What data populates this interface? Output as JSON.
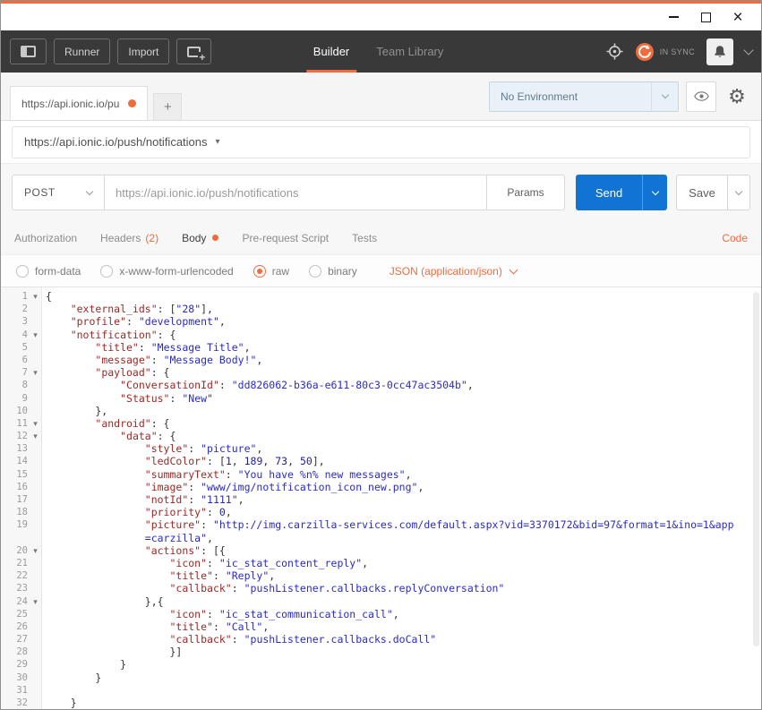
{
  "colors": {
    "accent_orange": "#f26b3a",
    "header_bg": "#393939",
    "send_button_blue": "#1173d4",
    "key_token": "#9c2724",
    "string_token": "#2a2ac9"
  },
  "icons": {
    "close_glyph": "×",
    "gear_glyph": "⚙",
    "caret_glyph": "▾",
    "fold_glyph": "▾"
  },
  "header": {
    "runner_label": "Runner",
    "import_label": "Import",
    "tabs": [
      {
        "label": "Builder",
        "active": true
      },
      {
        "label": "Team Library",
        "active": false
      }
    ],
    "sync_status": "IN SYNC"
  },
  "env_bar": {
    "request_tab": "https://api.ionic.io/pu",
    "new_tab_label": "+",
    "environment_select": "No Environment"
  },
  "request_name": "https://api.ionic.io/push/notifications",
  "request": {
    "method": "POST",
    "url": "https://api.ionic.io/push/notifications",
    "params_label": "Params",
    "send_label": "Send",
    "save_label": "Save"
  },
  "request_tabs": {
    "items": [
      {
        "label": "Authorization",
        "active": false
      },
      {
        "label": "Headers",
        "count": "(2)",
        "active": false
      },
      {
        "label": "Body",
        "active": true,
        "dot": true
      },
      {
        "label": "Pre-request Script",
        "active": false
      },
      {
        "label": "Tests",
        "active": false
      }
    ],
    "code_link": "Code"
  },
  "body_options": {
    "radios": [
      {
        "label": "form-data",
        "selected": false
      },
      {
        "label": "x-www-form-urlencoded",
        "selected": false
      },
      {
        "label": "raw",
        "selected": true
      },
      {
        "label": "binary",
        "selected": false
      }
    ],
    "content_type": "JSON (application/json)"
  },
  "editor": {
    "lines": [
      {
        "n": "1",
        "fold": true,
        "t": [
          [
            "p",
            "{"
          ]
        ]
      },
      {
        "n": "2",
        "t": [
          [
            "p",
            "    "
          ],
          [
            "k",
            "\"external_ids\""
          ],
          [
            "p",
            ": ["
          ],
          [
            "s",
            "\"28\""
          ],
          [
            "p",
            "],"
          ]
        ]
      },
      {
        "n": "3",
        "t": [
          [
            "p",
            "    "
          ],
          [
            "k",
            "\"profile\""
          ],
          [
            "p",
            ": "
          ],
          [
            "s",
            "\"development\""
          ],
          [
            "p",
            ","
          ]
        ]
      },
      {
        "n": "4",
        "fold": true,
        "t": [
          [
            "p",
            "    "
          ],
          [
            "k",
            "\"notification\""
          ],
          [
            "p",
            ": {"
          ]
        ]
      },
      {
        "n": "5",
        "t": [
          [
            "p",
            "        "
          ],
          [
            "k",
            "\"title\""
          ],
          [
            "p",
            ": "
          ],
          [
            "s",
            "\"Message Title\""
          ],
          [
            "p",
            ","
          ]
        ]
      },
      {
        "n": "6",
        "t": [
          [
            "p",
            "        "
          ],
          [
            "k",
            "\"message\""
          ],
          [
            "p",
            ": "
          ],
          [
            "s",
            "\"Message Body!\""
          ],
          [
            "p",
            ","
          ]
        ]
      },
      {
        "n": "7",
        "fold": true,
        "t": [
          [
            "p",
            "        "
          ],
          [
            "k",
            "\"payload\""
          ],
          [
            "p",
            ": {"
          ]
        ]
      },
      {
        "n": "8",
        "t": [
          [
            "p",
            "            "
          ],
          [
            "k",
            "\"ConversationId\""
          ],
          [
            "p",
            ": "
          ],
          [
            "s",
            "\"dd826062-b36a-e611-80c3-0cc47ac3504b\""
          ],
          [
            "p",
            ","
          ]
        ]
      },
      {
        "n": "9",
        "t": [
          [
            "p",
            "            "
          ],
          [
            "k",
            "\"Status\""
          ],
          [
            "p",
            ": "
          ],
          [
            "s",
            "\"New\""
          ]
        ]
      },
      {
        "n": "10",
        "t": [
          [
            "p",
            "        },"
          ]
        ]
      },
      {
        "n": "11",
        "fold": true,
        "t": [
          [
            "p",
            "        "
          ],
          [
            "k",
            "\"android\""
          ],
          [
            "p",
            ": {"
          ]
        ]
      },
      {
        "n": "12",
        "fold": true,
        "t": [
          [
            "p",
            "            "
          ],
          [
            "k",
            "\"data\""
          ],
          [
            "p",
            ": {"
          ]
        ]
      },
      {
        "n": "13",
        "t": [
          [
            "p",
            "                "
          ],
          [
            "k",
            "\"style\""
          ],
          [
            "p",
            ": "
          ],
          [
            "s",
            "\"picture\""
          ],
          [
            "p",
            ","
          ]
        ]
      },
      {
        "n": "14",
        "t": [
          [
            "p",
            "                "
          ],
          [
            "k",
            "\"ledColor\""
          ],
          [
            "p",
            ": ["
          ],
          [
            "d",
            "1"
          ],
          [
            "p",
            ", "
          ],
          [
            "d",
            "189"
          ],
          [
            "p",
            ", "
          ],
          [
            "d",
            "73"
          ],
          [
            "p",
            ", "
          ],
          [
            "d",
            "50"
          ],
          [
            "p",
            "],"
          ]
        ]
      },
      {
        "n": "15",
        "t": [
          [
            "p",
            "                "
          ],
          [
            "k",
            "\"summaryText\""
          ],
          [
            "p",
            ": "
          ],
          [
            "s",
            "\"You have %n% new messages\""
          ],
          [
            "p",
            ","
          ]
        ]
      },
      {
        "n": "16",
        "t": [
          [
            "p",
            "                "
          ],
          [
            "k",
            "\"image\""
          ],
          [
            "p",
            ": "
          ],
          [
            "s",
            "\"www/img/notification_icon_new.png\""
          ],
          [
            "p",
            ","
          ]
        ]
      },
      {
        "n": "17",
        "t": [
          [
            "p",
            "                "
          ],
          [
            "k",
            "\"notId\""
          ],
          [
            "p",
            ": "
          ],
          [
            "s",
            "\"1111\""
          ],
          [
            "p",
            ","
          ]
        ]
      },
      {
        "n": "18",
        "t": [
          [
            "p",
            "                "
          ],
          [
            "k",
            "\"priority\""
          ],
          [
            "p",
            ": "
          ],
          [
            "d",
            "0"
          ],
          [
            "p",
            ","
          ]
        ]
      },
      {
        "n": "19",
        "t": [
          [
            "p",
            "                "
          ],
          [
            "k",
            "\"picture\""
          ],
          [
            "p",
            ": "
          ],
          [
            "s",
            "\"http://img.carzilla-services.com/default.aspx?vid=3370172&bid=97&format=1&ino=1&app"
          ]
        ]
      },
      {
        "n": "",
        "t": [
          [
            "p",
            "                "
          ],
          [
            "s",
            "=carzilla\""
          ],
          [
            "p",
            ","
          ]
        ]
      },
      {
        "n": "20",
        "fold": true,
        "t": [
          [
            "p",
            "                "
          ],
          [
            "k",
            "\"actions\""
          ],
          [
            "p",
            ": [{"
          ]
        ]
      },
      {
        "n": "21",
        "t": [
          [
            "p",
            "                    "
          ],
          [
            "k",
            "\"icon\""
          ],
          [
            "p",
            ": "
          ],
          [
            "s",
            "\"ic_stat_content_reply\""
          ],
          [
            "p",
            ","
          ]
        ]
      },
      {
        "n": "22",
        "t": [
          [
            "p",
            "                    "
          ],
          [
            "k",
            "\"title\""
          ],
          [
            "p",
            ": "
          ],
          [
            "s",
            "\"Reply\""
          ],
          [
            "p",
            ","
          ]
        ]
      },
      {
        "n": "23",
        "t": [
          [
            "p",
            "                    "
          ],
          [
            "k",
            "\"callback\""
          ],
          [
            "p",
            ": "
          ],
          [
            "s",
            "\"pushListener.callbacks.replyConversation\""
          ]
        ]
      },
      {
        "n": "24",
        "fold": true,
        "t": [
          [
            "p",
            "                },{"
          ]
        ]
      },
      {
        "n": "25",
        "t": [
          [
            "p",
            "                    "
          ],
          [
            "k",
            "\"icon\""
          ],
          [
            "p",
            ": "
          ],
          [
            "s",
            "\"ic_stat_communication_call\""
          ],
          [
            "p",
            ","
          ]
        ]
      },
      {
        "n": "26",
        "t": [
          [
            "p",
            "                    "
          ],
          [
            "k",
            "\"title\""
          ],
          [
            "p",
            ": "
          ],
          [
            "s",
            "\"Call\""
          ],
          [
            "p",
            ","
          ]
        ]
      },
      {
        "n": "27",
        "t": [
          [
            "p",
            "                    "
          ],
          [
            "k",
            "\"callback\""
          ],
          [
            "p",
            ": "
          ],
          [
            "s",
            "\"pushListener.callbacks.doCall\""
          ]
        ]
      },
      {
        "n": "28",
        "t": [
          [
            "p",
            "                    }]"
          ]
        ]
      },
      {
        "n": "29",
        "t": [
          [
            "p",
            "            }"
          ]
        ]
      },
      {
        "n": "30",
        "t": [
          [
            "p",
            "        }"
          ]
        ]
      },
      {
        "n": "31",
        "t": []
      },
      {
        "n": "32",
        "t": [
          [
            "p",
            "    }"
          ]
        ]
      }
    ]
  }
}
